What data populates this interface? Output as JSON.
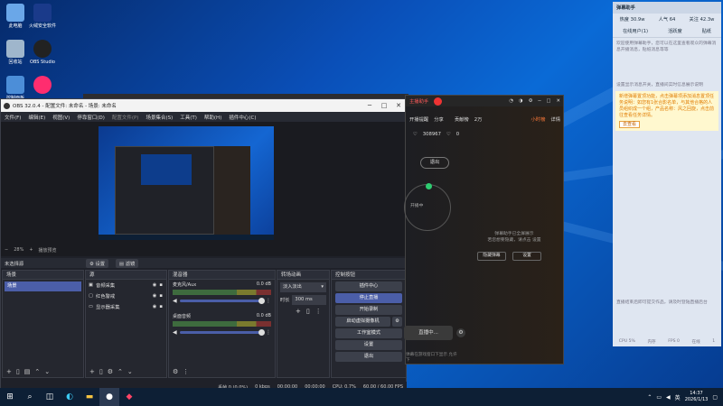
{
  "desktop": {
    "icons": [
      {
        "label": "此电脑"
      },
      {
        "label": "火绒安全软件"
      },
      {
        "label": "回收站"
      },
      {
        "label": "OBS Studio"
      },
      {
        "label": "控制面板"
      },
      {
        "label": ""
      }
    ]
  },
  "obs": {
    "title": "OBS 32.0.4 - 配置文件: 未命名 - 场景: 未命名",
    "menu": [
      "文件(F)",
      "编辑(E)",
      "视图(V)",
      "停靠窗口(D)",
      "配置文件(P)",
      "场景集合(S)",
      "工具(T)",
      "帮助(H)",
      "插件中心(C)"
    ],
    "zoom_label": "28%",
    "preview_bar_label": "播放预览",
    "source_toolbar": {
      "no_source": "未选择源",
      "props": "设置",
      "filters": "滤镜"
    },
    "scenes": {
      "title": "场景",
      "items": [
        "场景"
      ]
    },
    "sources": {
      "title": "源",
      "items": [
        "音频采集",
        "红色警戒",
        "显示器采集"
      ]
    },
    "mixer": {
      "title": "混音器",
      "tracks": [
        {
          "name": "麦克风/Aux",
          "db": "0.0 dB"
        },
        {
          "name": "桌面音频",
          "db": "0.0 dB"
        }
      ]
    },
    "transitions": {
      "title": "转场动画",
      "type": "淡入淡出",
      "duration_label": "时长",
      "duration": "300 ms"
    },
    "controls": {
      "title": "控制按钮",
      "buttons": [
        "插件中心",
        "停止直播",
        "开始录制",
        "启动虚拟摄像机",
        "工作室模式",
        "设置",
        "退出"
      ]
    },
    "status": {
      "frames": "丢帧 0 (0.0%)",
      "bitrate": "0 kbps",
      "time1": "00:00:00",
      "time2": "00:00:00",
      "cpu": "CPU: 0.7%",
      "fps": "60.00 / 60.00 FPS"
    }
  },
  "live": {
    "tabs": [
      "主播助手",
      "开播提醒",
      "分享",
      "贡献榜",
      "2万",
      "小时榜",
      "详情"
    ],
    "likes": "308967",
    "stats": "0",
    "disconnect": "退出",
    "watching_label": "开播中",
    "status_text": "弹幕助手已全屏展示",
    "hint": "若您想要隐藏，请点击 设置",
    "hide": "隐藏弹幕",
    "settings": "设置",
    "start_live": "直播中...",
    "footer": "弹幕在游戏窗口下显示   允许下"
  },
  "panel": {
    "title": "弹幕助手",
    "stats": [
      {
        "label": "热度",
        "value": "30.9w"
      },
      {
        "label": "人气",
        "value": "64"
      },
      {
        "label": "关注",
        "value": "42.3w"
      }
    ],
    "tabs": [
      "在线用户(1)",
      "活跃度",
      "贴纸"
    ],
    "notice1": "欢迎使用弹幕助手，您可以在这里查看观众的弹幕消息开播消息，贴纸消息等等",
    "line2": "设置显示消息开关，直播间实时信息展示说明",
    "notice2": "新增弹幕置顶功能，点击弹幕项添加消息置顶任务说明：如您有1张合影名单，与其他合格的人员组织成一个组，产品名称：风之回旋，点击前往查看任务详情。",
    "link": "去查看",
    "bottom": "直播结束后即可提交作品，请及时登陆直播后台",
    "footer": [
      "CPU 5%",
      "内存",
      "FPS 0",
      "在线",
      "1"
    ]
  },
  "taskbar": {
    "time": "14:37",
    "date": "2026/1/13"
  }
}
